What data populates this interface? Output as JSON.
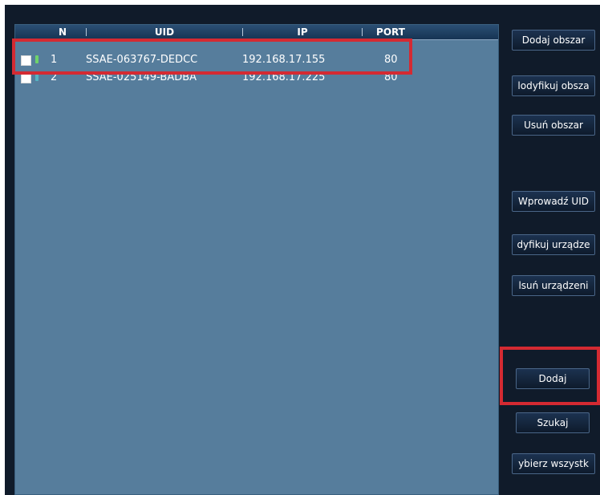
{
  "device_table": {
    "columns": [
      "N",
      "UID",
      "IP",
      "PORT"
    ],
    "rows": [
      {
        "n": "1",
        "uid": "SSAE-063767-DEDCC",
        "ip": "192.168.17.155",
        "port": "80",
        "status_color": "#6fd36b"
      },
      {
        "n": "2",
        "uid": "SSAE-025149-BADBA",
        "ip": "192.168.17.225",
        "port": "80",
        "status_color": "#55b3c3"
      }
    ]
  },
  "sidebar": {
    "add_area": "Dodaj obszar",
    "modify_area": "lodyfikuj obsza",
    "delete_area": "Usuń obszar",
    "enter_uid": "Wprowadź UID",
    "modify_device": "dyfikuj urządze",
    "delete_device": "lsuń urządzeni",
    "add": "Dodaj",
    "search": "Szukaj",
    "select_all": "ybierz wszystk"
  },
  "colors": {
    "highlight": "#d42a32",
    "list_background": "#567d9c",
    "app_background": "#101b2a"
  }
}
